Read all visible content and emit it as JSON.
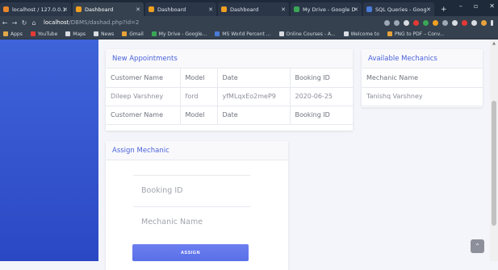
{
  "browser": {
    "tabs": [
      {
        "label": "localhost / 127.0.0.1",
        "fav": "#e8862b"
      },
      {
        "label": "Dashboard",
        "fav": "#f0a020",
        "active": true
      },
      {
        "label": "Dashboard",
        "fav": "#f0a020"
      },
      {
        "label": "Dashboard",
        "fav": "#f0a020"
      },
      {
        "label": "My Drive - Google D",
        "fav": "#3aa757"
      },
      {
        "label": "SQL Queries - Goog",
        "fav": "#4a7bd8"
      }
    ],
    "url_host": "localhost",
    "url_path": "/DBMS/dashad.php?id=2",
    "bookmarks": [
      {
        "label": "Apps",
        "color": "#e0a84a"
      },
      {
        "label": "YouTube",
        "color": "#e53935"
      },
      {
        "label": "Maps",
        "color": "#d9dce2"
      },
      {
        "label": "News",
        "color": "#d9dce2"
      },
      {
        "label": "Gmail",
        "color": "#e8a23a"
      },
      {
        "label": "My Drive - Google...",
        "color": "#3aa757"
      },
      {
        "label": "MS World Percent ...",
        "color": "#4a7bd8"
      },
      {
        "label": "Online Courses - A...",
        "color": "#d9dce2"
      },
      {
        "label": "Welcome to",
        "color": "#d9dce2"
      },
      {
        "label": "PNG to PDF – Conv...",
        "color": "#e8a23a"
      }
    ]
  },
  "new_appointments": {
    "title": "New Appointments",
    "rows": [
      [
        "Customer Name",
        "Model",
        "Date",
        "Booking ID"
      ],
      [
        "Dileep Varshney",
        "ford",
        "yfMLqxEo2meP9",
        "2020-06-25"
      ],
      [
        "Customer Name",
        "Model",
        "Date",
        "Booking ID"
      ]
    ]
  },
  "available_mechanics": {
    "title": "Available Mechanics",
    "rows": [
      [
        "Mechanic Name"
      ],
      [
        "Tanishq Varshney"
      ]
    ]
  },
  "assign_mechanic": {
    "title": "Assign Mechanic",
    "booking_placeholder": "Booking ID",
    "mechanic_placeholder": "Mechanic Name",
    "button_label": "ASSIGN"
  },
  "scroll_top_icon": "chevron-up-icon"
}
